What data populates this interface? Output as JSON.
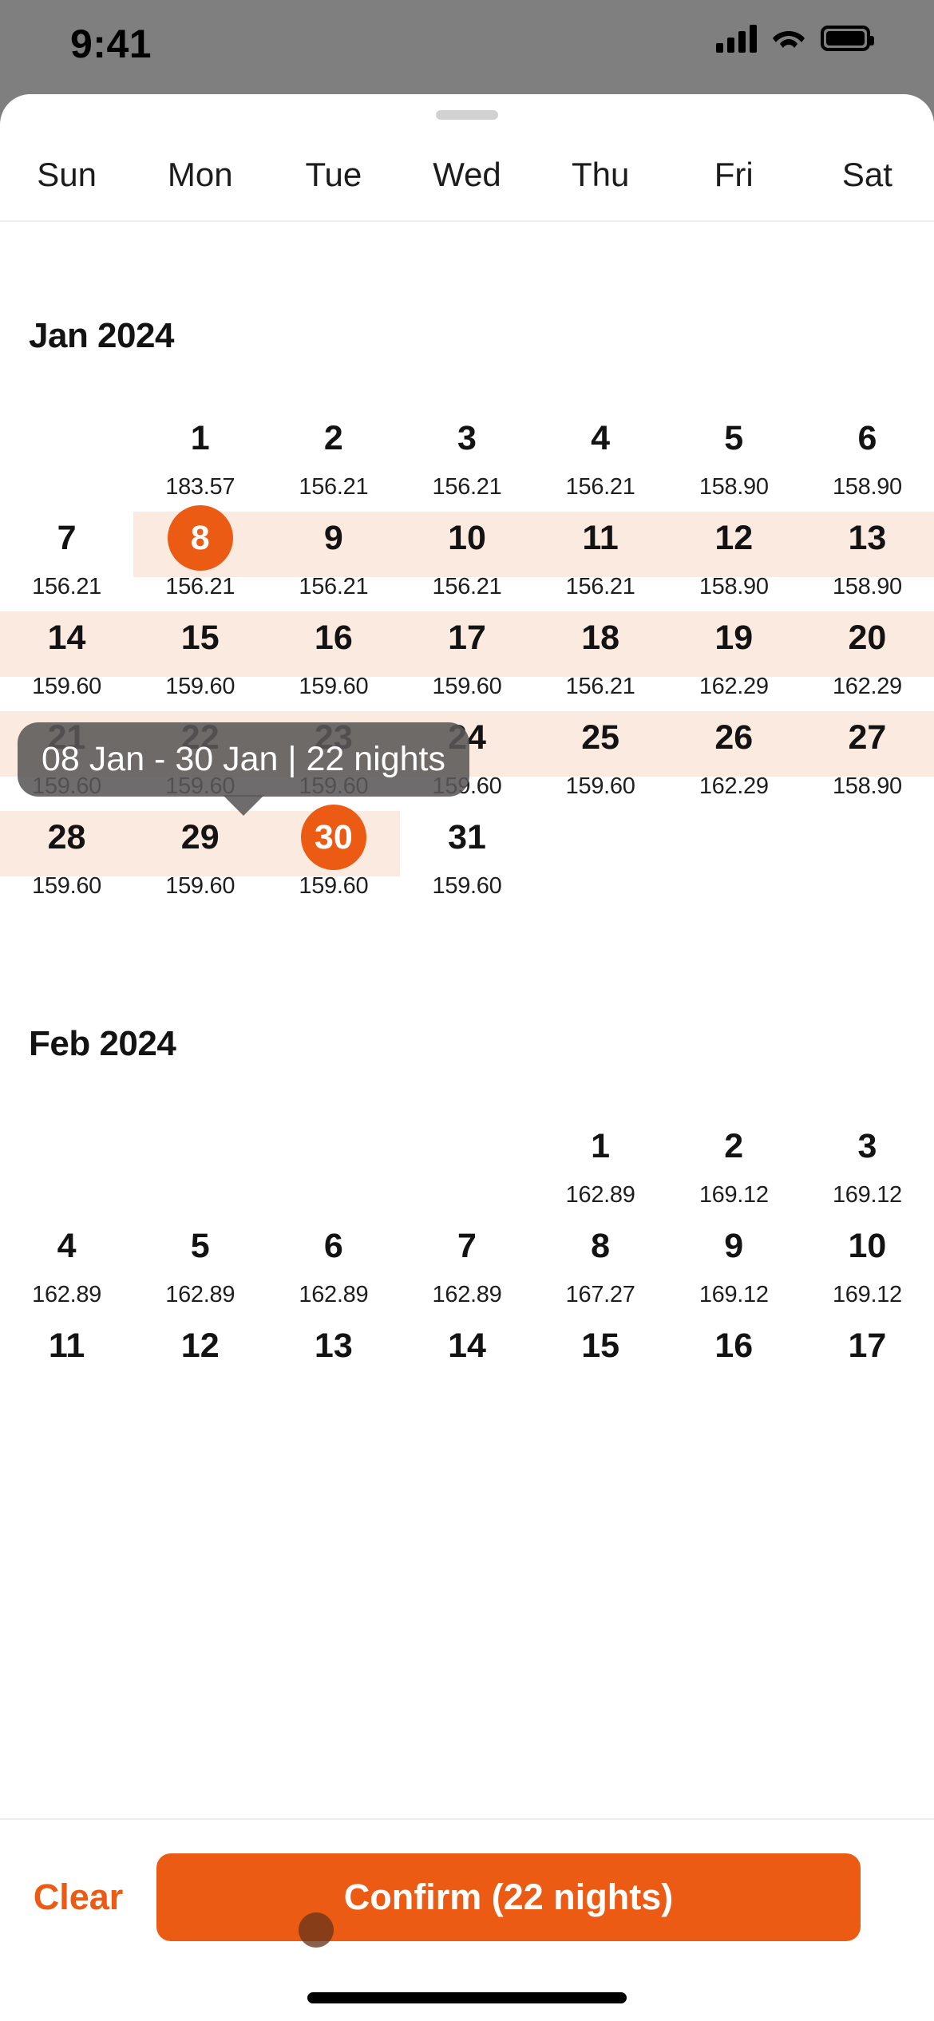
{
  "status_bar": {
    "time": "9:41",
    "cellular_icon": "signal-bars-icon",
    "wifi_icon": "wifi-icon",
    "battery_icon": "battery-icon"
  },
  "sheet": {
    "grabber_icon": "drag-handle-icon",
    "weekdays": [
      "Sun",
      "Mon",
      "Tue",
      "Wed",
      "Thu",
      "Fri",
      "Sat"
    ]
  },
  "selection": {
    "start_date": "08 Jan",
    "end_date": "30 Jan",
    "nights": 22,
    "tooltip_text": "08 Jan - 30 Jan | 22 nights",
    "accent_color": "#ec5b13",
    "range_band_color": "#fbeadf"
  },
  "months": [
    {
      "title": "Jan 2024",
      "lead_blanks": 1,
      "weeks": [
        {
          "band": null,
          "days": [
            {
              "day": "1",
              "price": "183.57",
              "state": "normal"
            },
            {
              "day": "2",
              "price": "156.21",
              "state": "normal"
            },
            {
              "day": "3",
              "price": "156.21",
              "state": "normal"
            },
            {
              "day": "4",
              "price": "156.21",
              "state": "normal"
            },
            {
              "day": "5",
              "price": "158.90",
              "state": "normal"
            },
            {
              "day": "6",
              "price": "158.90",
              "state": "normal"
            }
          ]
        },
        {
          "band": {
            "from": 1,
            "to": 6
          },
          "days": [
            {
              "day": "7",
              "price": "156.21",
              "state": "normal"
            },
            {
              "day": "8",
              "price": "156.21",
              "state": "selected-start"
            },
            {
              "day": "9",
              "price": "156.21",
              "state": "in-range"
            },
            {
              "day": "10",
              "price": "156.21",
              "state": "in-range"
            },
            {
              "day": "11",
              "price": "156.21",
              "state": "in-range"
            },
            {
              "day": "12",
              "price": "158.90",
              "state": "in-range"
            },
            {
              "day": "13",
              "price": "158.90",
              "state": "in-range"
            }
          ]
        },
        {
          "band": {
            "from": 0,
            "to": 6
          },
          "days": [
            {
              "day": "14",
              "price": "159.60",
              "state": "in-range"
            },
            {
              "day": "15",
              "price": "159.60",
              "state": "in-range"
            },
            {
              "day": "16",
              "price": "159.60",
              "state": "in-range"
            },
            {
              "day": "17",
              "price": "159.60",
              "state": "in-range"
            },
            {
              "day": "18",
              "price": "156.21",
              "state": "in-range"
            },
            {
              "day": "19",
              "price": "162.29",
              "state": "in-range"
            },
            {
              "day": "20",
              "price": "162.29",
              "state": "in-range"
            }
          ]
        },
        {
          "band": {
            "from": 0,
            "to": 6
          },
          "days": [
            {
              "day": "21",
              "price": "159.60",
              "state": "in-range"
            },
            {
              "day": "22",
              "price": "159.60",
              "state": "in-range"
            },
            {
              "day": "23",
              "price": "159.60",
              "state": "in-range"
            },
            {
              "day": "24",
              "price": "159.60",
              "state": "in-range"
            },
            {
              "day": "25",
              "price": "159.60",
              "state": "in-range"
            },
            {
              "day": "26",
              "price": "162.29",
              "state": "in-range"
            },
            {
              "day": "27",
              "price": "158.90",
              "state": "in-range"
            }
          ]
        },
        {
          "band": {
            "from": 0,
            "to": 2
          },
          "days": [
            {
              "day": "28",
              "price": "159.60",
              "state": "in-range"
            },
            {
              "day": "29",
              "price": "159.60",
              "state": "in-range"
            },
            {
              "day": "30",
              "price": "159.60",
              "state": "selected-end"
            },
            {
              "day": "31",
              "price": "159.60",
              "state": "normal"
            }
          ]
        }
      ]
    },
    {
      "title": "Feb 2024",
      "lead_blanks": 4,
      "weeks": [
        {
          "band": null,
          "days": [
            {
              "day": "1",
              "price": "162.89",
              "state": "normal"
            },
            {
              "day": "2",
              "price": "169.12",
              "state": "normal"
            },
            {
              "day": "3",
              "price": "169.12",
              "state": "normal"
            }
          ]
        },
        {
          "band": null,
          "days": [
            {
              "day": "4",
              "price": "162.89",
              "state": "normal"
            },
            {
              "day": "5",
              "price": "162.89",
              "state": "normal"
            },
            {
              "day": "6",
              "price": "162.89",
              "state": "normal"
            },
            {
              "day": "7",
              "price": "162.89",
              "state": "normal"
            },
            {
              "day": "8",
              "price": "167.27",
              "state": "normal"
            },
            {
              "day": "9",
              "price": "169.12",
              "state": "normal"
            },
            {
              "day": "10",
              "price": "169.12",
              "state": "normal"
            }
          ]
        },
        {
          "band": null,
          "days": [
            {
              "day": "11",
              "price": "",
              "state": "normal"
            },
            {
              "day": "12",
              "price": "",
              "state": "normal"
            },
            {
              "day": "13",
              "price": "",
              "state": "normal"
            },
            {
              "day": "14",
              "price": "",
              "state": "normal"
            },
            {
              "day": "15",
              "price": "",
              "state": "normal"
            },
            {
              "day": "16",
              "price": "",
              "state": "normal"
            },
            {
              "day": "17",
              "price": "",
              "state": "normal"
            }
          ]
        }
      ]
    }
  ],
  "footer": {
    "clear_label": "Clear",
    "confirm_label": "Confirm (22 nights)",
    "home_indicator": "home-bar-icon"
  }
}
